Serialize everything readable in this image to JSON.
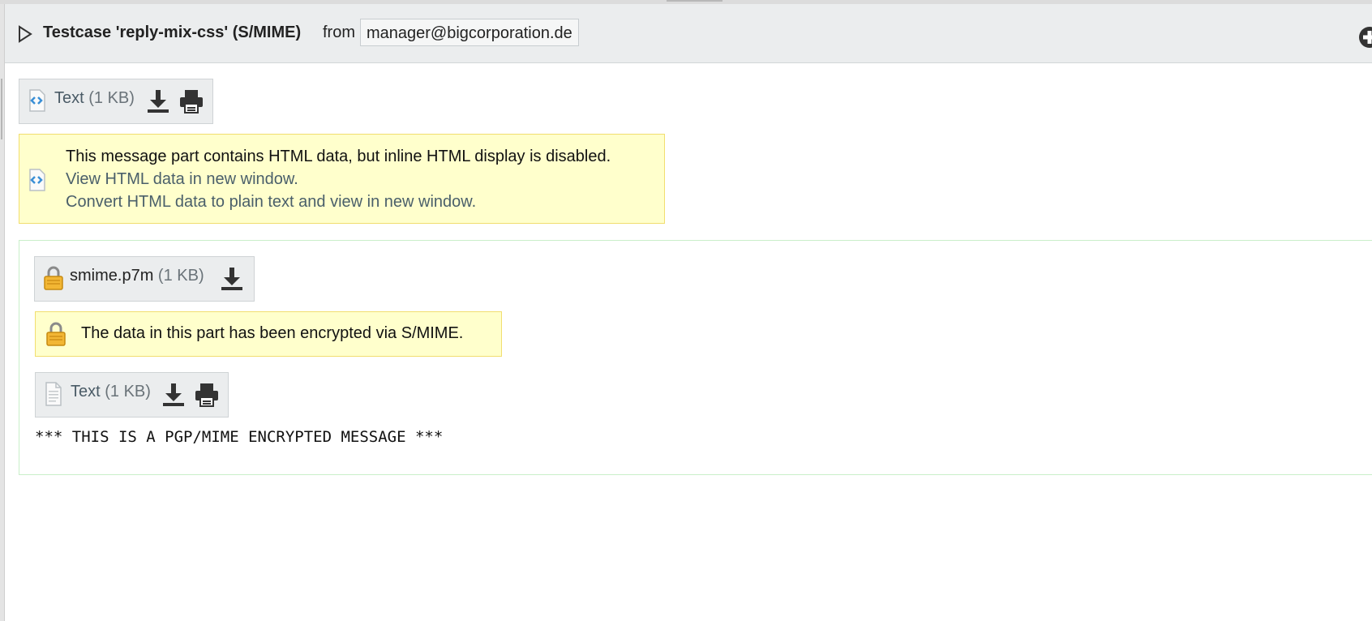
{
  "header": {
    "title": "Testcase 'reply-mix-css' (S/MIME)",
    "from_label": "from",
    "sender_email": "manager@bigcorporation.de"
  },
  "html_part": {
    "name": "Text",
    "size": "(1 KB)",
    "notice": {
      "message": "This message part contains HTML data, but inline HTML display is disabled.",
      "view_link": "View HTML data in new window.",
      "convert_link": "Convert HTML data to plain text and view in new window."
    }
  },
  "smime_part": {
    "name": "smime.p7m",
    "size": "(1 KB)",
    "notice": "The data in this part has been encrypted via S/MIME."
  },
  "inner_text_part": {
    "name": "Text",
    "size": "(1 KB)",
    "body": "*** THIS IS A PGP/MIME ENCRYPTED MESSAGE ***"
  },
  "icons": {
    "toggle": "disclosure-triangle-icon",
    "add": "plus-circle-icon",
    "html": "html-document-icon",
    "text": "text-document-icon",
    "lock": "lock-icon",
    "download": "download-icon",
    "print": "print-icon"
  },
  "colors": {
    "header_bg": "#ebedee",
    "notice_bg": "#ffffcc",
    "notice_border": "#f1de6f",
    "link": "#4a5f6a",
    "container_border": "#c9efc9"
  }
}
